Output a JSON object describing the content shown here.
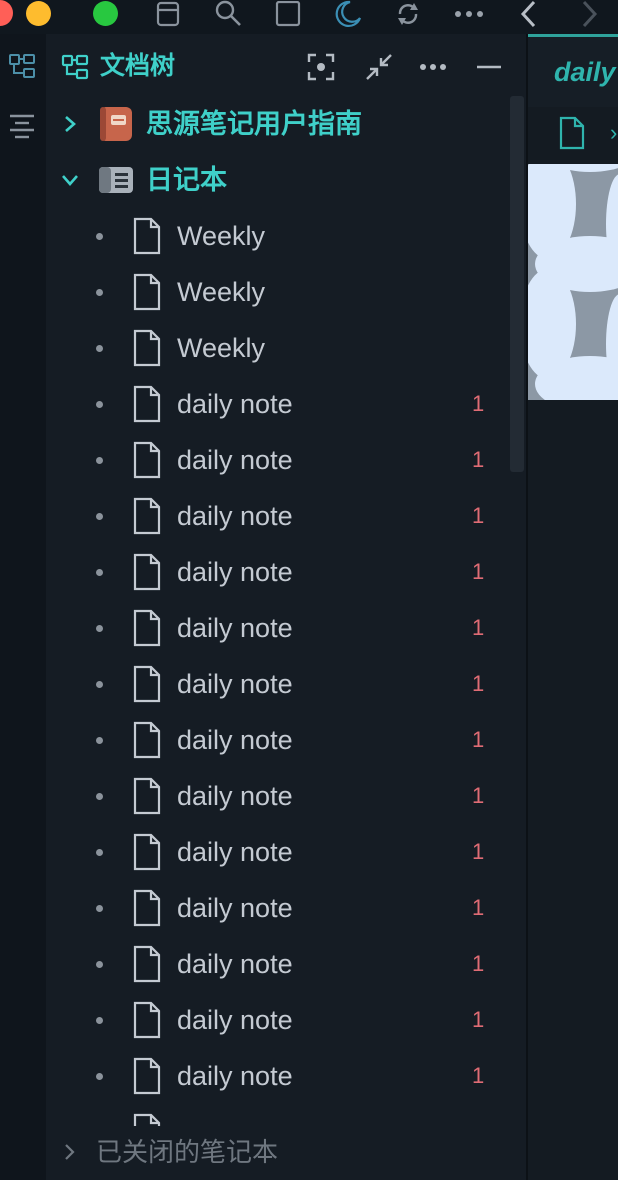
{
  "colors": {
    "accent": "#3fd0c9",
    "tab_accent": "#2fb4ad",
    "count": "#e06c75",
    "panel_bg": "#151c24",
    "traffic_close": "#ff5f57",
    "traffic_min": "#febc2e",
    "traffic_max": "#28c840"
  },
  "toolbar": {
    "icons": [
      "calendar-icon",
      "search-icon",
      "square-icon",
      "moon-icon",
      "sync-icon",
      "more-icon",
      "back-icon",
      "forward-icon"
    ]
  },
  "left_rail": {
    "icons": [
      "file-tree-icon",
      "outline-icon"
    ]
  },
  "panel": {
    "title": "文档树",
    "actions": [
      "focus-icon",
      "collapse-icon",
      "more-icon",
      "minimize-icon"
    ]
  },
  "tree": {
    "notebooks": [
      {
        "name": "思源笔记用户指南",
        "expanded": false,
        "icon": "book-icon"
      },
      {
        "name": "日记本",
        "expanded": true,
        "icon": "notebook-icon"
      }
    ],
    "documents": [
      {
        "title": "Weekly",
        "count": ""
      },
      {
        "title": "Weekly",
        "count": ""
      },
      {
        "title": "Weekly",
        "count": ""
      },
      {
        "title": "daily note",
        "count": "1"
      },
      {
        "title": "daily note",
        "count": "1"
      },
      {
        "title": "daily note",
        "count": "1"
      },
      {
        "title": "daily note",
        "count": "1"
      },
      {
        "title": "daily note",
        "count": "1"
      },
      {
        "title": "daily note",
        "count": "1"
      },
      {
        "title": "daily note",
        "count": "1"
      },
      {
        "title": "daily note",
        "count": "1"
      },
      {
        "title": "daily note",
        "count": "1"
      },
      {
        "title": "daily note",
        "count": "1"
      },
      {
        "title": "daily note",
        "count": "1"
      },
      {
        "title": "daily note",
        "count": "1"
      },
      {
        "title": "daily note",
        "count": "1"
      }
    ]
  },
  "footer": {
    "closed_notebooks_label": "已关闭的笔记本"
  },
  "editor": {
    "tab_title": "daily"
  }
}
